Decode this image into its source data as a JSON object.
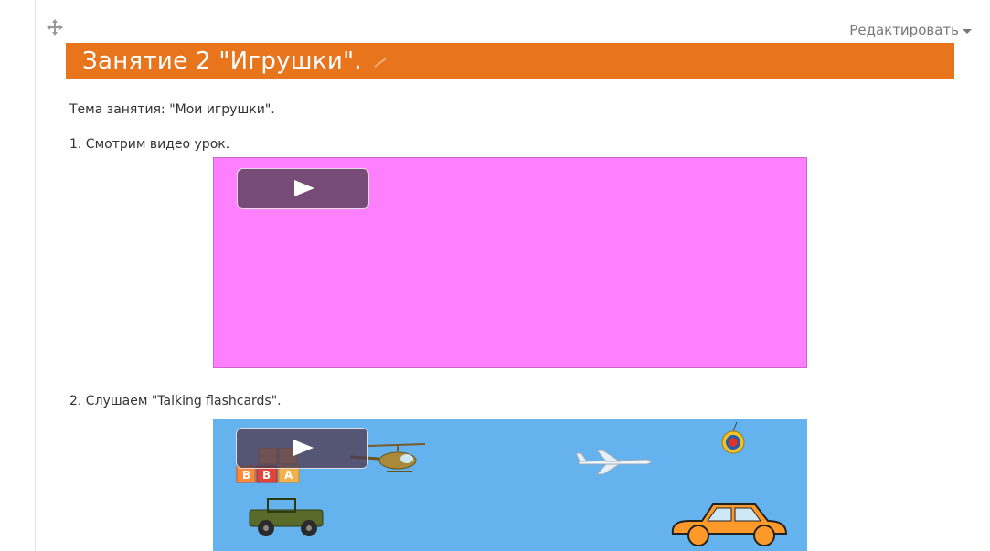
{
  "header": {
    "edit_label": "Редактировать"
  },
  "section": {
    "title": "Занятие 2 \"Игрушки\".",
    "topic": "Тема занятия: \"Мои игрушки\".",
    "step1": "1. Смотрим видео урок.",
    "step2": "2. Слушаем \"Talking flashcards\"."
  },
  "blocks_letters": [
    "B",
    "B",
    "A"
  ],
  "colors": {
    "section_header": "#e8741c",
    "video1_bg": "#ff80ff",
    "video2_bg": "#64b3ef",
    "play_button": "#503c50"
  }
}
